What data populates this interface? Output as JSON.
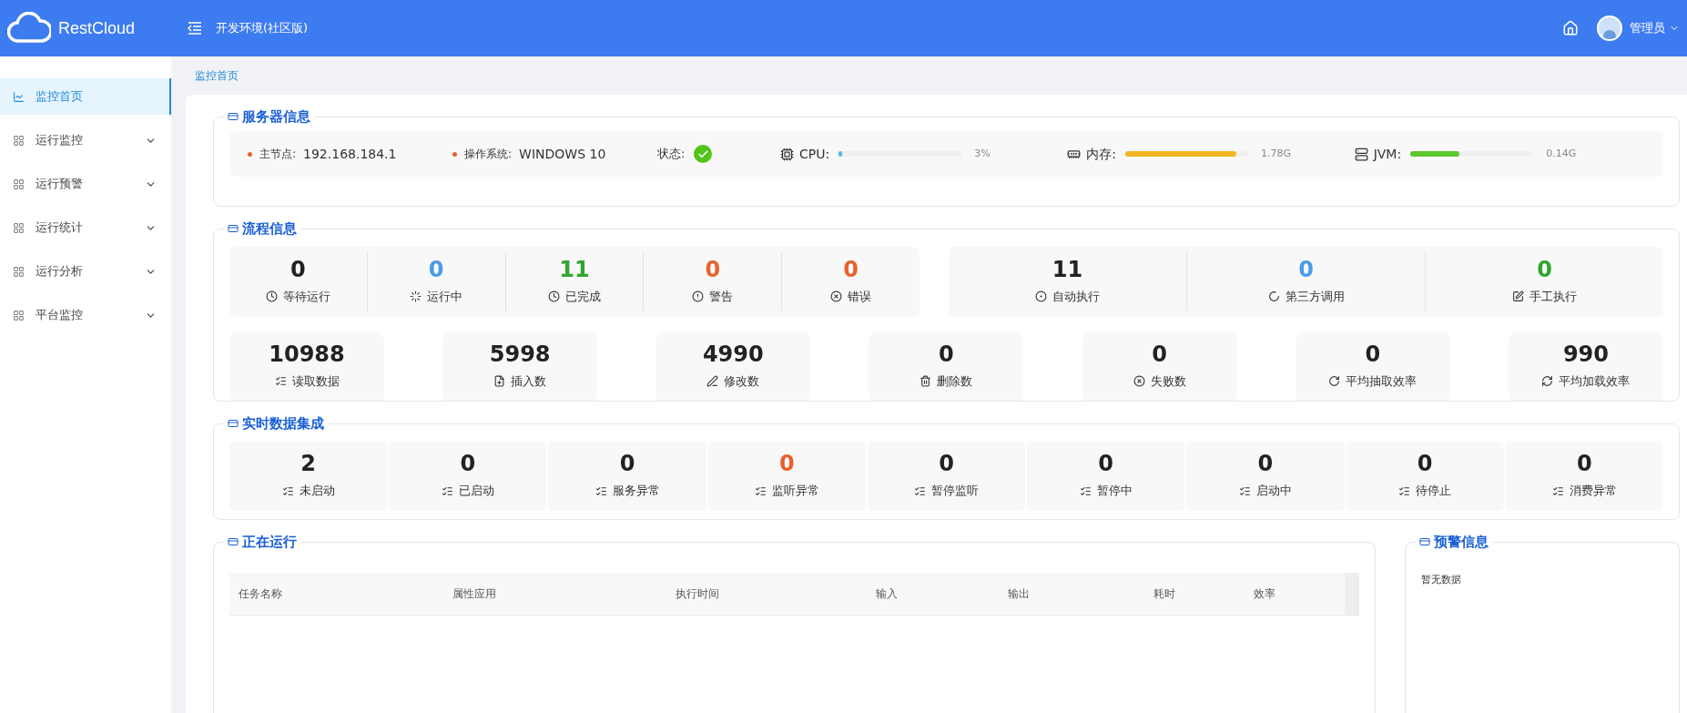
{
  "header": {
    "logo": "RestCloud",
    "env": "开发环境(社区版)",
    "user": "管理员"
  },
  "sidebar": {
    "items": [
      {
        "label": "监控首页",
        "selected": true,
        "expandable": false
      },
      {
        "label": "运行监控",
        "selected": false,
        "expandable": true
      },
      {
        "label": "运行预警",
        "selected": false,
        "expandable": true
      },
      {
        "label": "运行统计",
        "selected": false,
        "expandable": true
      },
      {
        "label": "运行分析",
        "selected": false,
        "expandable": true
      },
      {
        "label": "平台监控",
        "selected": false,
        "expandable": true
      }
    ]
  },
  "breadcrumb": "监控首页",
  "server_info": {
    "title": "服务器信息",
    "fields": [
      {
        "label": "主节点:",
        "value": "192.168.184.1"
      },
      {
        "label": "操作系统:",
        "value": "WINDOWS 10"
      }
    ],
    "status": {
      "label": "状态:",
      "ok": true
    },
    "meters": [
      {
        "label": "CPU:",
        "level": 0.03,
        "reading": "3%",
        "color": "#4fb8f0"
      },
      {
        "label": "内存:",
        "level": 0.9,
        "reading": "1.78G",
        "color": "#f5b51f"
      },
      {
        "label": "JVM:",
        "level": 0.4,
        "reading": "0.14G",
        "color": "#5cc72e"
      }
    ]
  },
  "flow_info": {
    "title": "流程信息",
    "status_group": [
      {
        "value": "0",
        "label": "等待运行",
        "color": "#222222"
      },
      {
        "value": "0",
        "label": "运行中",
        "color": "#4a9be8"
      },
      {
        "value": "11",
        "label": "已完成",
        "color": "#2fa62f"
      },
      {
        "value": "0",
        "label": "警告",
        "color": "#e8612c"
      },
      {
        "value": "0",
        "label": "错误",
        "color": "#e8612c"
      }
    ],
    "mode_group": [
      {
        "value": "11",
        "label": "自动执行",
        "color": "#222222"
      },
      {
        "value": "0",
        "label": "第三方调用",
        "color": "#4a9be8"
      },
      {
        "value": "0",
        "label": "手工执行",
        "color": "#2fa62f"
      }
    ],
    "counters": [
      {
        "value": "10988",
        "label": "读取数据"
      },
      {
        "value": "5998",
        "label": "插入数"
      },
      {
        "value": "4990",
        "label": "修改数"
      },
      {
        "value": "0",
        "label": "删除数"
      },
      {
        "value": "0",
        "label": "失败数"
      },
      {
        "value": "0",
        "label": "平均抽取效率"
      },
      {
        "value": "990",
        "label": "平均加载效率"
      }
    ]
  },
  "realtime": {
    "title": "实时数据集成",
    "items": [
      {
        "value": "2",
        "label": "未启动",
        "color": "#222222"
      },
      {
        "value": "0",
        "label": "已启动",
        "color": "#222222"
      },
      {
        "value": "0",
        "label": "服务异常",
        "color": "#222222"
      },
      {
        "value": "0",
        "label": "监听异常",
        "color": "#e8612c"
      },
      {
        "value": "0",
        "label": "暂停监听",
        "color": "#222222"
      },
      {
        "value": "0",
        "label": "暂停中",
        "color": "#222222"
      },
      {
        "value": "0",
        "label": "启动中",
        "color": "#222222"
      },
      {
        "value": "0",
        "label": "待停止",
        "color": "#222222"
      },
      {
        "value": "0",
        "label": "消费异常",
        "color": "#222222"
      }
    ]
  },
  "running": {
    "title": "正在运行",
    "columns": [
      "任务名称",
      "属性应用",
      "执行时间",
      "输入",
      "输出",
      "耗时",
      "效率"
    ]
  },
  "warnings": {
    "title": "预警信息",
    "empty": "暂无数据"
  }
}
